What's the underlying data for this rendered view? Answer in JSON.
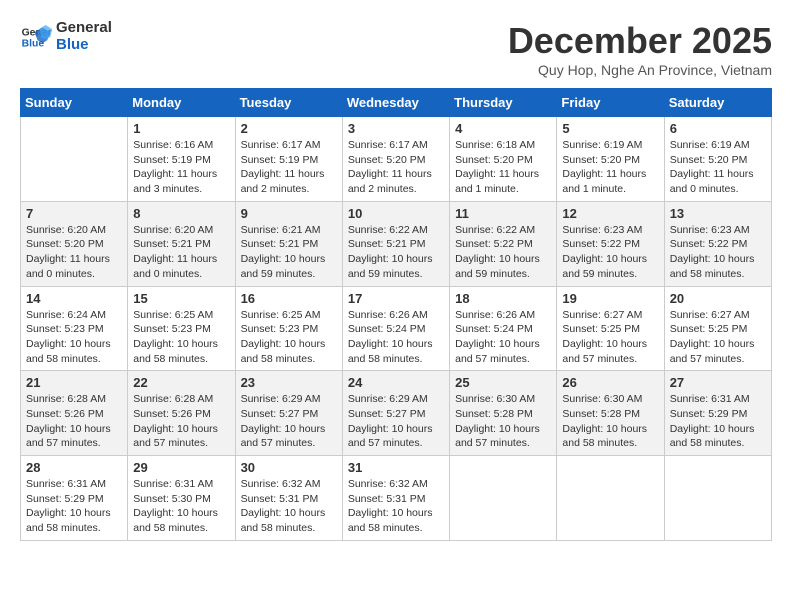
{
  "logo": {
    "line1": "General",
    "line2": "Blue"
  },
  "title": "December 2025",
  "location": "Quy Hop, Nghe An Province, Vietnam",
  "days_header": [
    "Sunday",
    "Monday",
    "Tuesday",
    "Wednesday",
    "Thursday",
    "Friday",
    "Saturday"
  ],
  "weeks": [
    [
      {
        "day": "",
        "info": ""
      },
      {
        "day": "1",
        "info": "Sunrise: 6:16 AM\nSunset: 5:19 PM\nDaylight: 11 hours\nand 3 minutes."
      },
      {
        "day": "2",
        "info": "Sunrise: 6:17 AM\nSunset: 5:19 PM\nDaylight: 11 hours\nand 2 minutes."
      },
      {
        "day": "3",
        "info": "Sunrise: 6:17 AM\nSunset: 5:20 PM\nDaylight: 11 hours\nand 2 minutes."
      },
      {
        "day": "4",
        "info": "Sunrise: 6:18 AM\nSunset: 5:20 PM\nDaylight: 11 hours\nand 1 minute."
      },
      {
        "day": "5",
        "info": "Sunrise: 6:19 AM\nSunset: 5:20 PM\nDaylight: 11 hours\nand 1 minute."
      },
      {
        "day": "6",
        "info": "Sunrise: 6:19 AM\nSunset: 5:20 PM\nDaylight: 11 hours\nand 0 minutes."
      }
    ],
    [
      {
        "day": "7",
        "info": "Sunrise: 6:20 AM\nSunset: 5:20 PM\nDaylight: 11 hours\nand 0 minutes."
      },
      {
        "day": "8",
        "info": "Sunrise: 6:20 AM\nSunset: 5:21 PM\nDaylight: 11 hours\nand 0 minutes."
      },
      {
        "day": "9",
        "info": "Sunrise: 6:21 AM\nSunset: 5:21 PM\nDaylight: 10 hours\nand 59 minutes."
      },
      {
        "day": "10",
        "info": "Sunrise: 6:22 AM\nSunset: 5:21 PM\nDaylight: 10 hours\nand 59 minutes."
      },
      {
        "day": "11",
        "info": "Sunrise: 6:22 AM\nSunset: 5:22 PM\nDaylight: 10 hours\nand 59 minutes."
      },
      {
        "day": "12",
        "info": "Sunrise: 6:23 AM\nSunset: 5:22 PM\nDaylight: 10 hours\nand 59 minutes."
      },
      {
        "day": "13",
        "info": "Sunrise: 6:23 AM\nSunset: 5:22 PM\nDaylight: 10 hours\nand 58 minutes."
      }
    ],
    [
      {
        "day": "14",
        "info": "Sunrise: 6:24 AM\nSunset: 5:23 PM\nDaylight: 10 hours\nand 58 minutes."
      },
      {
        "day": "15",
        "info": "Sunrise: 6:25 AM\nSunset: 5:23 PM\nDaylight: 10 hours\nand 58 minutes."
      },
      {
        "day": "16",
        "info": "Sunrise: 6:25 AM\nSunset: 5:23 PM\nDaylight: 10 hours\nand 58 minutes."
      },
      {
        "day": "17",
        "info": "Sunrise: 6:26 AM\nSunset: 5:24 PM\nDaylight: 10 hours\nand 58 minutes."
      },
      {
        "day": "18",
        "info": "Sunrise: 6:26 AM\nSunset: 5:24 PM\nDaylight: 10 hours\nand 57 minutes."
      },
      {
        "day": "19",
        "info": "Sunrise: 6:27 AM\nSunset: 5:25 PM\nDaylight: 10 hours\nand 57 minutes."
      },
      {
        "day": "20",
        "info": "Sunrise: 6:27 AM\nSunset: 5:25 PM\nDaylight: 10 hours\nand 57 minutes."
      }
    ],
    [
      {
        "day": "21",
        "info": "Sunrise: 6:28 AM\nSunset: 5:26 PM\nDaylight: 10 hours\nand 57 minutes."
      },
      {
        "day": "22",
        "info": "Sunrise: 6:28 AM\nSunset: 5:26 PM\nDaylight: 10 hours\nand 57 minutes."
      },
      {
        "day": "23",
        "info": "Sunrise: 6:29 AM\nSunset: 5:27 PM\nDaylight: 10 hours\nand 57 minutes."
      },
      {
        "day": "24",
        "info": "Sunrise: 6:29 AM\nSunset: 5:27 PM\nDaylight: 10 hours\nand 57 minutes."
      },
      {
        "day": "25",
        "info": "Sunrise: 6:30 AM\nSunset: 5:28 PM\nDaylight: 10 hours\nand 57 minutes."
      },
      {
        "day": "26",
        "info": "Sunrise: 6:30 AM\nSunset: 5:28 PM\nDaylight: 10 hours\nand 58 minutes."
      },
      {
        "day": "27",
        "info": "Sunrise: 6:31 AM\nSunset: 5:29 PM\nDaylight: 10 hours\nand 58 minutes."
      }
    ],
    [
      {
        "day": "28",
        "info": "Sunrise: 6:31 AM\nSunset: 5:29 PM\nDaylight: 10 hours\nand 58 minutes."
      },
      {
        "day": "29",
        "info": "Sunrise: 6:31 AM\nSunset: 5:30 PM\nDaylight: 10 hours\nand 58 minutes."
      },
      {
        "day": "30",
        "info": "Sunrise: 6:32 AM\nSunset: 5:31 PM\nDaylight: 10 hours\nand 58 minutes."
      },
      {
        "day": "31",
        "info": "Sunrise: 6:32 AM\nSunset: 5:31 PM\nDaylight: 10 hours\nand 58 minutes."
      },
      {
        "day": "",
        "info": ""
      },
      {
        "day": "",
        "info": ""
      },
      {
        "day": "",
        "info": ""
      }
    ]
  ]
}
